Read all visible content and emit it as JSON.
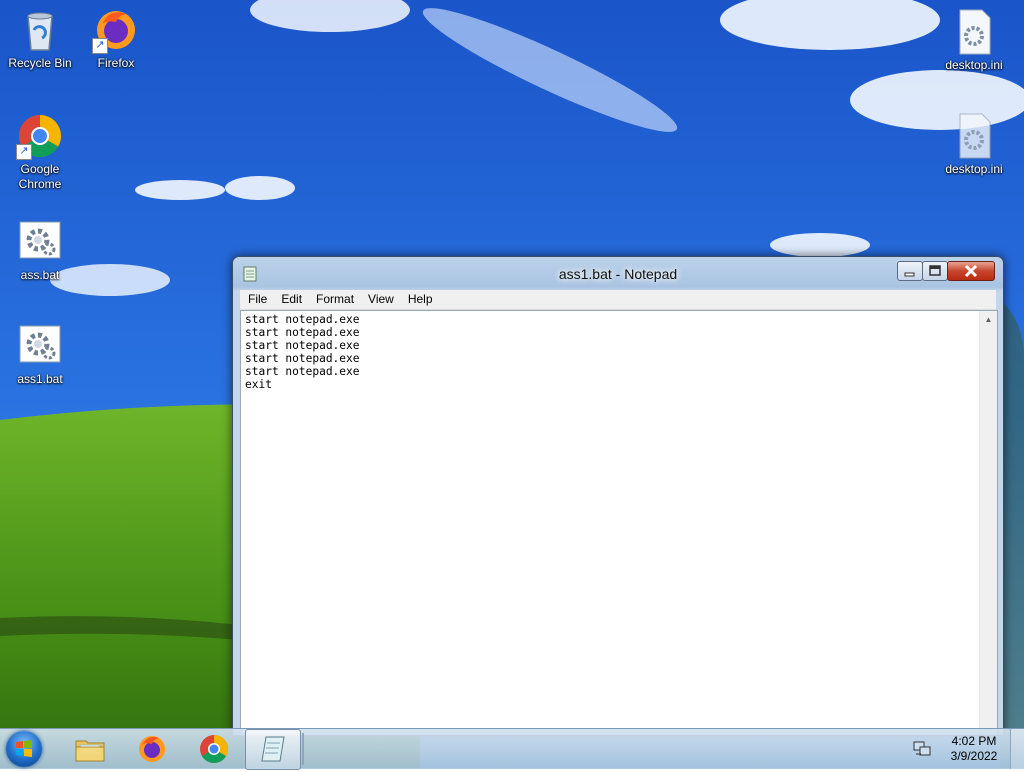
{
  "desktop": {
    "icons": [
      {
        "label": "Recycle Bin",
        "icon": "recycle-bin-icon"
      },
      {
        "label": "Firefox",
        "icon": "firefox-icon"
      },
      {
        "label": "Google\nChrome",
        "icon": "chrome-icon"
      },
      {
        "label": "ass.bat",
        "icon": "batch-file-icon"
      },
      {
        "label": "ass1.bat",
        "icon": "batch-file-icon"
      },
      {
        "label": "desktop.ini",
        "icon": "settings-file-icon"
      },
      {
        "label": "desktop.ini",
        "icon": "settings-file-icon"
      }
    ]
  },
  "notepad": {
    "title": "ass1.bat - Notepad",
    "menu": [
      "File",
      "Edit",
      "Format",
      "View",
      "Help"
    ],
    "content": "start notepad.exe\nstart notepad.exe\nstart notepad.exe\nstart notepad.exe\nstart notepad.exe\nexit",
    "scroll_up_glyph": "▲"
  },
  "taskbar": {
    "pinned": [
      "windows-explorer-icon",
      "firefox-icon",
      "chrome-icon",
      "notepad-icon"
    ],
    "tray_icon": "network-icon",
    "clock_time": "4:02 PM",
    "clock_date": "3/9/2022"
  },
  "colors": {
    "sky": "#1f5fd0",
    "grass": "#4f9a1c",
    "titlebar": "#bcd2ea",
    "close_button": "#c7452c"
  }
}
